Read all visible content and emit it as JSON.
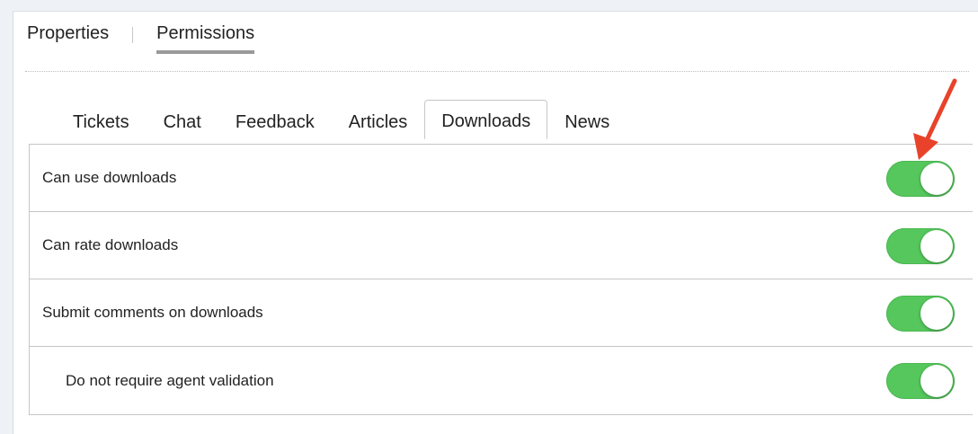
{
  "top_tabs": [
    "Properties",
    "Permissions"
  ],
  "active_top_tab": "Permissions",
  "sub_tabs": [
    "Tickets",
    "Chat",
    "Feedback",
    "Articles",
    "Downloads",
    "News"
  ],
  "active_sub_tab": "Downloads",
  "permissions": [
    {
      "label": "Can use downloads",
      "enabled": true
    },
    {
      "label": "Can rate downloads",
      "enabled": true
    },
    {
      "label": "Submit comments on downloads",
      "enabled": true
    },
    {
      "label": "Do not require agent validation",
      "enabled": true
    }
  ],
  "colors": {
    "toggle_on": "#55c75c",
    "arrow": "#e8432a",
    "tab_underline": "#9a9a9a"
  },
  "icons": {
    "annotation": "red-arrow-icon"
  }
}
